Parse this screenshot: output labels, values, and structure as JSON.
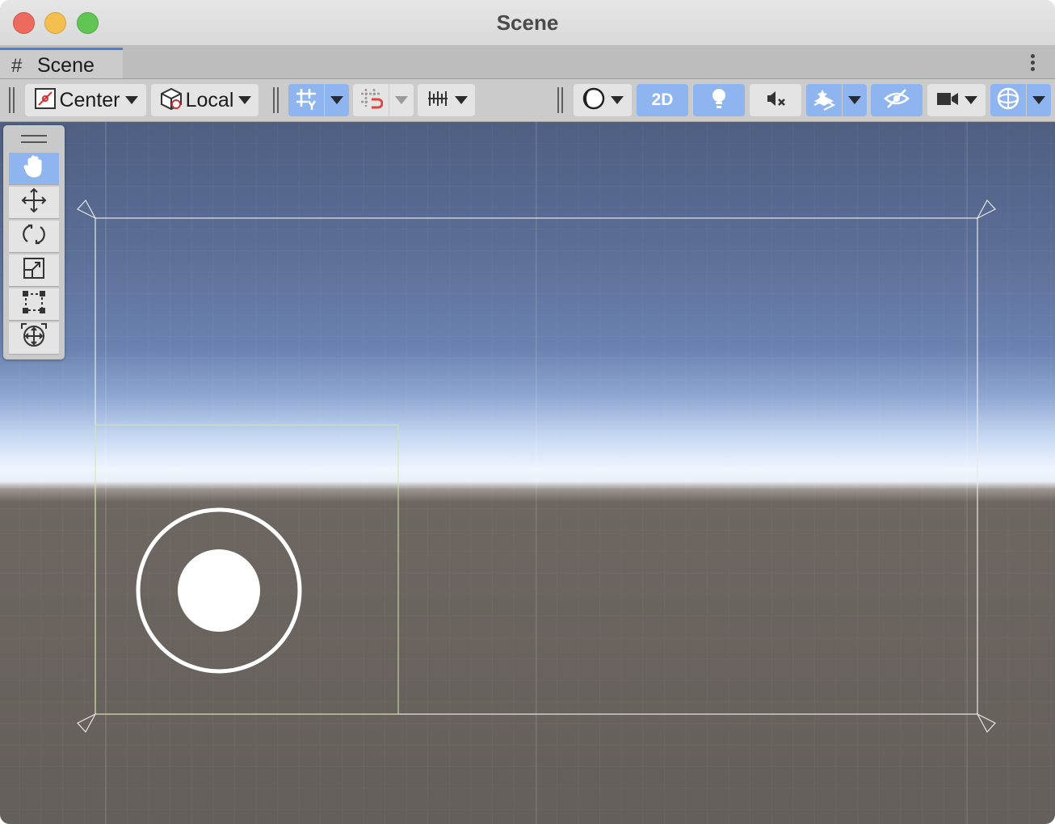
{
  "window": {
    "title": "Scene"
  },
  "tab": {
    "icon": "grid-hash-icon",
    "label": "Scene"
  },
  "toolbar": {
    "pivot_mode": "Center",
    "pivot_rotation": "Local",
    "mode_2d_label": "2D",
    "icons": {
      "pivot": "pivot-center-icon",
      "rotation": "local-cube-icon",
      "grid_visibility": "grid-visibility-icon",
      "grid_snapping": "grid-snap-icon",
      "increment_snap": "increment-snap-icon",
      "shading": "shading-mode-icon",
      "lighting": "lightbulb-icon",
      "audio": "audio-mute-icon",
      "effects": "effects-layers-icon",
      "hidden_objects": "hidden-eye-icon",
      "camera": "camera-icon",
      "gizmos": "gizmos-sphere-icon"
    },
    "states": {
      "grid_visibility": "on",
      "grid_snapping": "off",
      "mode_2d": "on",
      "lighting": "on",
      "audio": "off",
      "effects": "on",
      "hidden_objects": "on",
      "gizmos": "on"
    }
  },
  "tools": {
    "active": "view-tool",
    "items": [
      {
        "name": "view-tool",
        "icon": "hand-icon"
      },
      {
        "name": "move-tool",
        "icon": "move-arrows-icon"
      },
      {
        "name": "rotate-tool",
        "icon": "rotate-icon"
      },
      {
        "name": "scale-tool",
        "icon": "scale-icon"
      },
      {
        "name": "rect-tool",
        "icon": "rect-transform-icon"
      },
      {
        "name": "transform-tool",
        "icon": "transform-icon"
      }
    ]
  },
  "colors": {
    "accent_active": "#8fb5f0",
    "sky_top": "#4f5f82",
    "horizon": "#f0f6ff",
    "ground": "#655f5b",
    "canvas_outline": "#e8e8e8",
    "rect_outline": "#cfe6a8"
  }
}
